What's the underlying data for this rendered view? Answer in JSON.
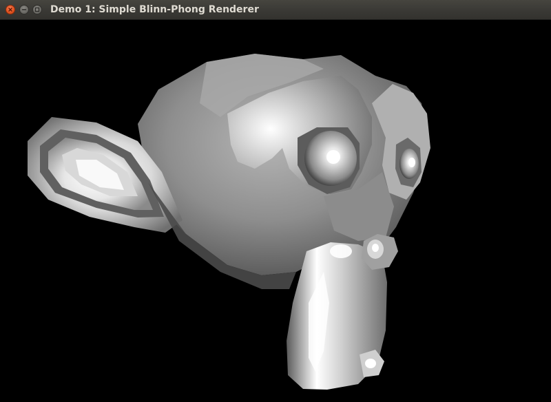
{
  "window": {
    "title": "Demo 1: Simple Blinn-Phong Renderer",
    "controls": {
      "close_color": "#e2531f",
      "button_color": "#6a6964"
    }
  },
  "viewport": {
    "background": "#000000",
    "scene": "suzanne-monkey-head",
    "shading": "blinn-phong",
    "material_color": "#9a9a9a"
  }
}
